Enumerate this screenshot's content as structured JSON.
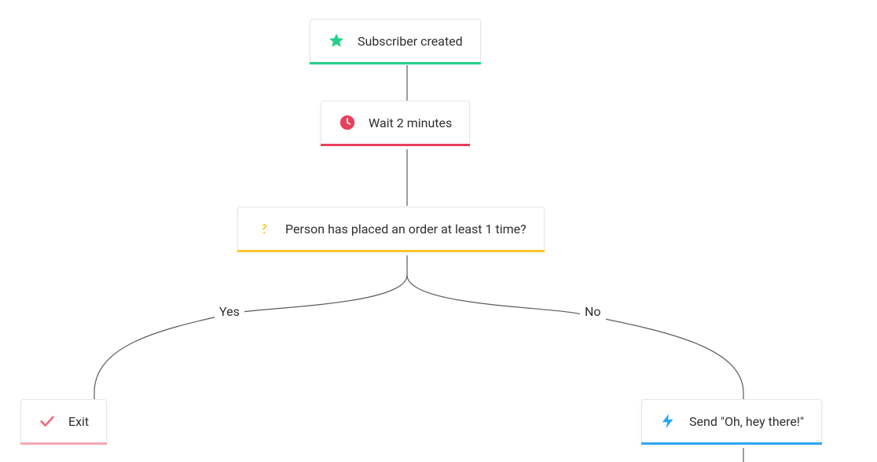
{
  "nodes": {
    "trigger": {
      "label": "Subscriber created",
      "icon": "star-icon",
      "color": "#23d18b",
      "underline": "green"
    },
    "wait": {
      "label": "Wait 2 minutes",
      "icon": "clock-icon",
      "color": "#e83f5b",
      "underline": "red"
    },
    "condition": {
      "label": "Person has placed an order at least 1 time?",
      "icon": "question-icon",
      "color": "#ffc727",
      "underline": "yellow"
    },
    "exit": {
      "label": "Exit",
      "icon": "check-icon",
      "color": "#f7a6b5",
      "underline": "pink"
    },
    "send": {
      "label": "Send \"Oh, hey there!\"",
      "icon": "bolt-icon",
      "color": "#2ca7f2",
      "underline": "blue"
    }
  },
  "branches": {
    "yes": "Yes",
    "no": "No"
  }
}
